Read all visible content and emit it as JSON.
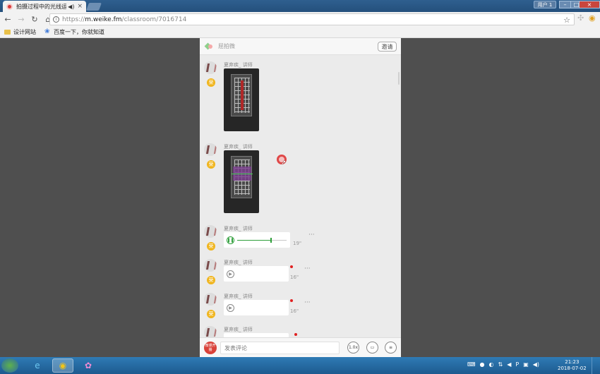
{
  "browser": {
    "tab_title": "拍摄过程中的光线运用",
    "tab_audio": "◀)",
    "tab_close": "×",
    "user_button": "用户 1",
    "minimize": "–",
    "maximize": "□",
    "close": "×",
    "url_scheme": "https://",
    "url_host": "m.weike.fm",
    "url_path": "/classroom/7016714",
    "star": "☆",
    "bookmarks": [
      {
        "label": "设计网站"
      },
      {
        "label": "百度一下，你就知道"
      }
    ]
  },
  "panel": {
    "brand": "屈拍微",
    "invite_label": "邀请",
    "messages": [
      {
        "sender": "夏弃疾_ 讲师",
        "badge": "荣",
        "type": "image"
      },
      {
        "sender": "夏弃疾_ 讲师",
        "badge": "荣",
        "type": "image"
      },
      {
        "sender": "夏弃疾_ 讲师",
        "badge": "荣",
        "type": "voice",
        "duration": "19\"",
        "playing": true,
        "progress": 0.68
      },
      {
        "sender": "夏弃疾_ 讲师",
        "badge": "荣",
        "type": "voice",
        "duration": "16\"",
        "playing": false
      },
      {
        "sender": "夏弃疾_ 讲师",
        "badge": "荣",
        "type": "voice",
        "duration": "16\"",
        "playing": false
      },
      {
        "sender": "夏弃疾_ 讲师",
        "badge": "荣",
        "type": "voice",
        "duration": "",
        "playing": false
      }
    ],
    "more": "···",
    "comment_bar": {
      "host_badge": "微课开播",
      "placeholder": "发表评论",
      "speed_label": "1.0x"
    }
  },
  "taskbar": {
    "time": "21:23",
    "date": "2018-07-02"
  },
  "colors": {
    "accent_green": "#2e9e3a",
    "badge_gold": "#f0b51e",
    "unread_red": "#e02020"
  }
}
